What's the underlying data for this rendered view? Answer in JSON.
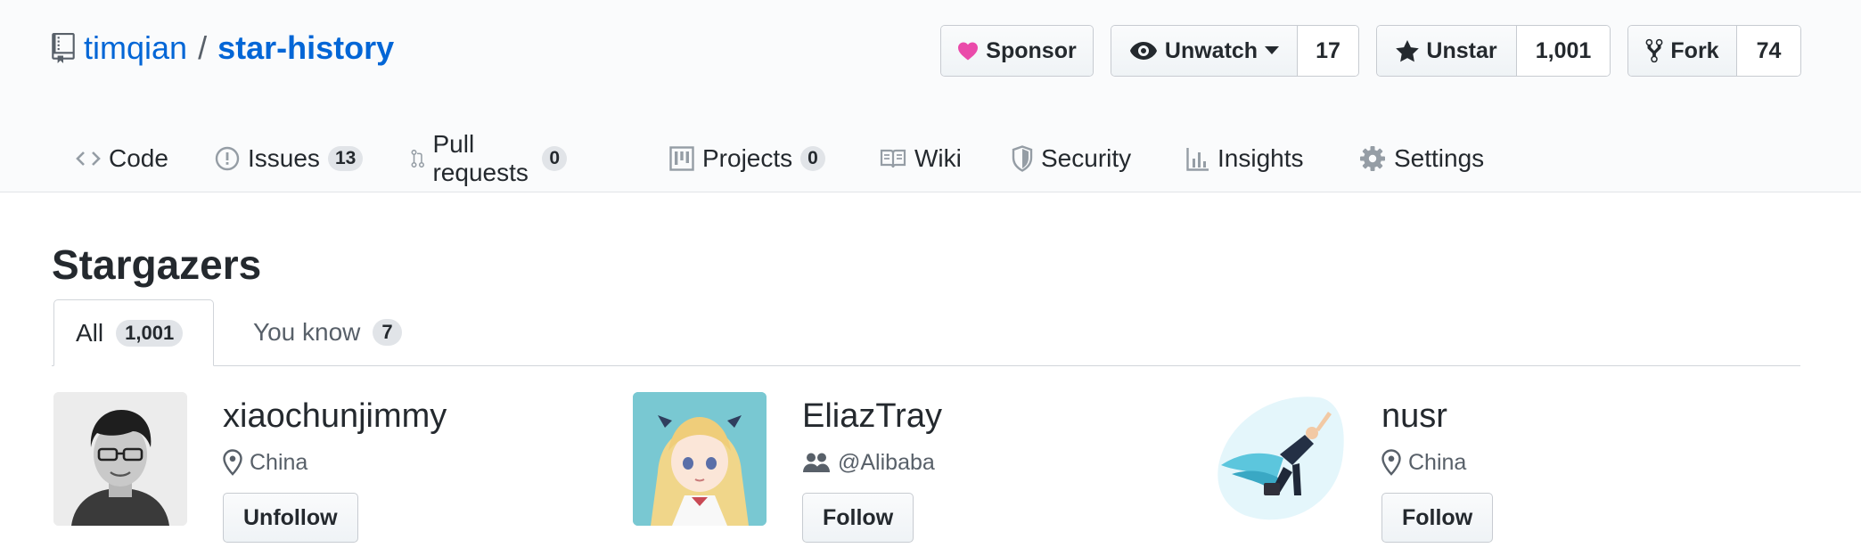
{
  "repo": {
    "owner": "timqian",
    "separator": "/",
    "name": "star-history"
  },
  "actions": {
    "sponsor": {
      "label": "Sponsor"
    },
    "watch": {
      "label": "Unwatch",
      "count": "17"
    },
    "star": {
      "label": "Unstar",
      "count": "1,001"
    },
    "fork": {
      "label": "Fork",
      "count": "74"
    }
  },
  "nav_tabs": [
    {
      "label": "Code",
      "icon": "code-icon"
    },
    {
      "label": "Issues",
      "counter": "13",
      "icon": "issue-icon"
    },
    {
      "label": "Pull requests",
      "counter": "0",
      "icon": "pull-request-icon"
    },
    {
      "label": "Projects",
      "counter": "0",
      "icon": "project-icon"
    },
    {
      "label": "Wiki",
      "icon": "book-icon"
    },
    {
      "label": "Security",
      "icon": "shield-icon"
    },
    {
      "label": "Insights",
      "icon": "graph-icon"
    },
    {
      "label": "Settings",
      "icon": "gear-icon"
    }
  ],
  "page_title": "Stargazers",
  "sub_tabs": [
    {
      "label": "All",
      "counter": "1,001",
      "selected": true
    },
    {
      "label": "You know",
      "counter": "7",
      "selected": false
    }
  ],
  "users": [
    {
      "username": "xiaochunjimmy",
      "meta": "China",
      "meta_icon": "location-icon",
      "button": "Unfollow"
    },
    {
      "username": "EliazTray",
      "meta": "@Alibaba",
      "meta_icon": "organization-icon",
      "button": "Follow"
    },
    {
      "username": "nusr",
      "meta": "China",
      "meta_icon": "location-icon",
      "button": "Follow"
    }
  ],
  "colors": {
    "link": "#0366d6",
    "sponsor_heart": "#ea4aaa",
    "text": "#24292e",
    "muted": "#586069"
  }
}
